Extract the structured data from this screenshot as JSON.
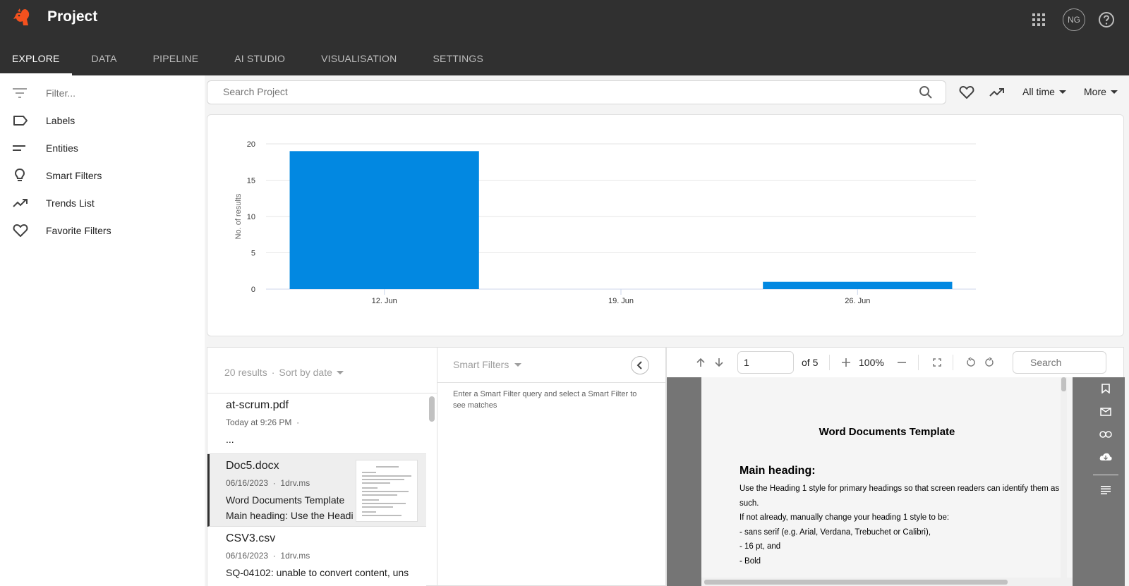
{
  "app": {
    "title": "Project",
    "user_initials": "NG",
    "icons": [
      "squirrel-logo-icon",
      "apps-grid-icon",
      "help-icon"
    ]
  },
  "nav": {
    "tabs": [
      {
        "label": "EXPLORE",
        "active": true
      },
      {
        "label": "DATA",
        "active": false
      },
      {
        "label": "PIPELINE",
        "active": false
      },
      {
        "label": "AI STUDIO",
        "active": false
      },
      {
        "label": "VISUALISATION",
        "active": false
      },
      {
        "label": "SETTINGS",
        "active": false
      }
    ]
  },
  "sidebar": {
    "filter_placeholder": "Filter...",
    "items": [
      {
        "label": "Labels",
        "icon": "label-icon"
      },
      {
        "label": "Entities",
        "icon": "entities-icon"
      },
      {
        "label": "Smart Filters",
        "icon": "lightbulb-icon"
      },
      {
        "label": "Trends List",
        "icon": "trending-icon"
      },
      {
        "label": "Favorite Filters",
        "icon": "heart-icon"
      }
    ]
  },
  "search": {
    "placeholder": "Search Project",
    "time_filter": "All time",
    "more_label": "More"
  },
  "colors": {
    "header_bg": "#303030",
    "bar_color": "#0288e1",
    "accent": "#f4511e"
  },
  "chart_data": {
    "type": "bar",
    "categories": [
      "12. Jun",
      "19. Jun",
      "26. Jun"
    ],
    "values": [
      19,
      0,
      1
    ],
    "title": "",
    "xlabel": "",
    "ylabel": "No. of results",
    "ylim": [
      0,
      20
    ],
    "yticks": [
      0,
      5,
      10,
      15,
      20
    ],
    "grid": true
  },
  "results": {
    "summary": "20 results",
    "separator": "·",
    "sort_label": "Sort by date",
    "items": [
      {
        "title": "at-scrum.pdf",
        "date": "Today at 9:26 PM",
        "source": "",
        "meta_separator": "·",
        "snippet": [
          "..."
        ],
        "selected": false,
        "has_thumbnail": false
      },
      {
        "title": "Doc5.docx",
        "date": "06/16/2023",
        "source": "1drv.ms",
        "meta_separator": "·",
        "snippet": [
          "Word Documents Template",
          "Main heading: Use the Headi"
        ],
        "selected": true,
        "has_thumbnail": true
      },
      {
        "title": "CSV3.csv",
        "date": "06/16/2023",
        "source": "1drv.ms",
        "meta_separator": "·",
        "snippet": [
          "SQ-04102: unable to convert content, uns"
        ],
        "selected": false,
        "has_thumbnail": false
      }
    ]
  },
  "smart_filters": {
    "label": "Smart Filters",
    "message": "Enter a Smart Filter query and select a Smart Filter to see matches"
  },
  "viewer": {
    "page_value": "1",
    "page_of": "of 5",
    "zoom": "100%",
    "search_placeholder": "Search",
    "document": {
      "title": "Word Documents Template",
      "heading": "Main heading:",
      "lines": [
        "Use the Heading 1 style for primary headings so that screen readers can identify them as",
        "such.",
        "If not already, manually change your heading 1 style to be:",
        " - sans serif (e.g. Arial, Verdana, Trebuchet or Calibri),",
        " - 16 pt, and",
        " - Bold"
      ]
    }
  }
}
